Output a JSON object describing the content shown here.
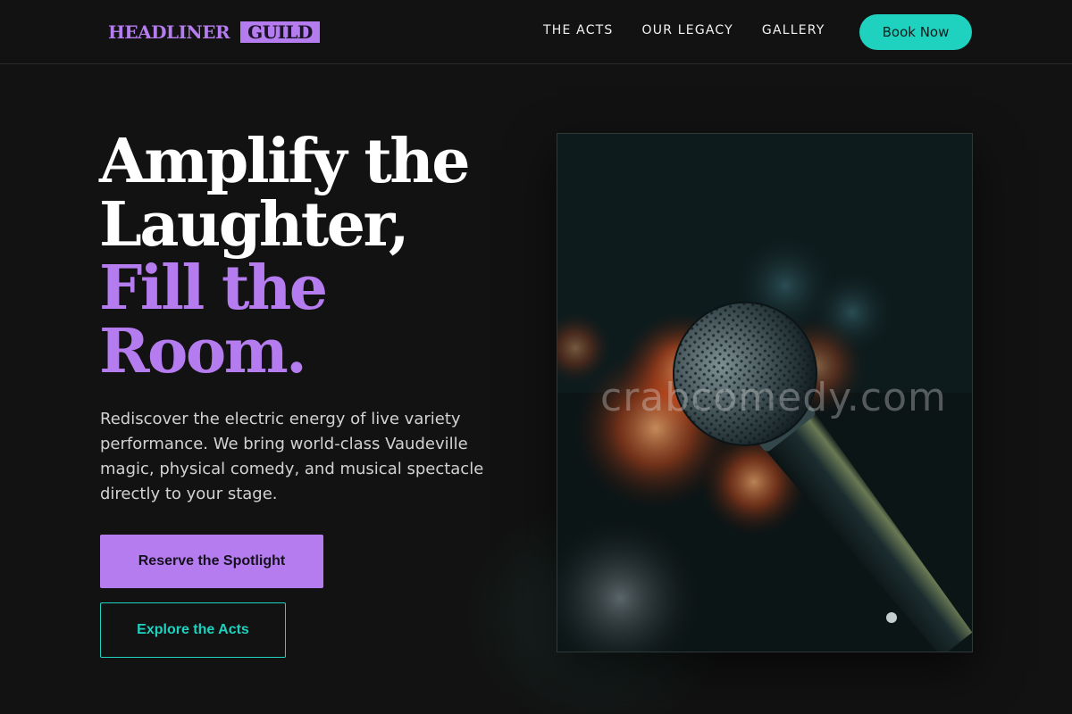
{
  "brand": {
    "name": "HEADLINER",
    "tag": "GUILD"
  },
  "nav": {
    "items": [
      "THE ACTS",
      "OUR LEGACY",
      "GALLERY"
    ],
    "cta": "Book Now"
  },
  "hero": {
    "line1": "Amplify the",
    "line2": "Laughter,",
    "line3": "Fill the",
    "line4": "Room.",
    "lede": "Rediscover the electric energy of live variety performance. We bring world-class Vaudeville magic, physical comedy, and musical spectacle directly to your stage.",
    "primary_cta": "Reserve the Spotlight",
    "secondary_cta": "Explore the Acts"
  },
  "photo": {
    "watermark": "crabcomedy.com",
    "subject": "microphone-photo"
  },
  "colors": {
    "accent": "#b57cf0",
    "teal": "#1ed2bf",
    "background": "#121212"
  }
}
